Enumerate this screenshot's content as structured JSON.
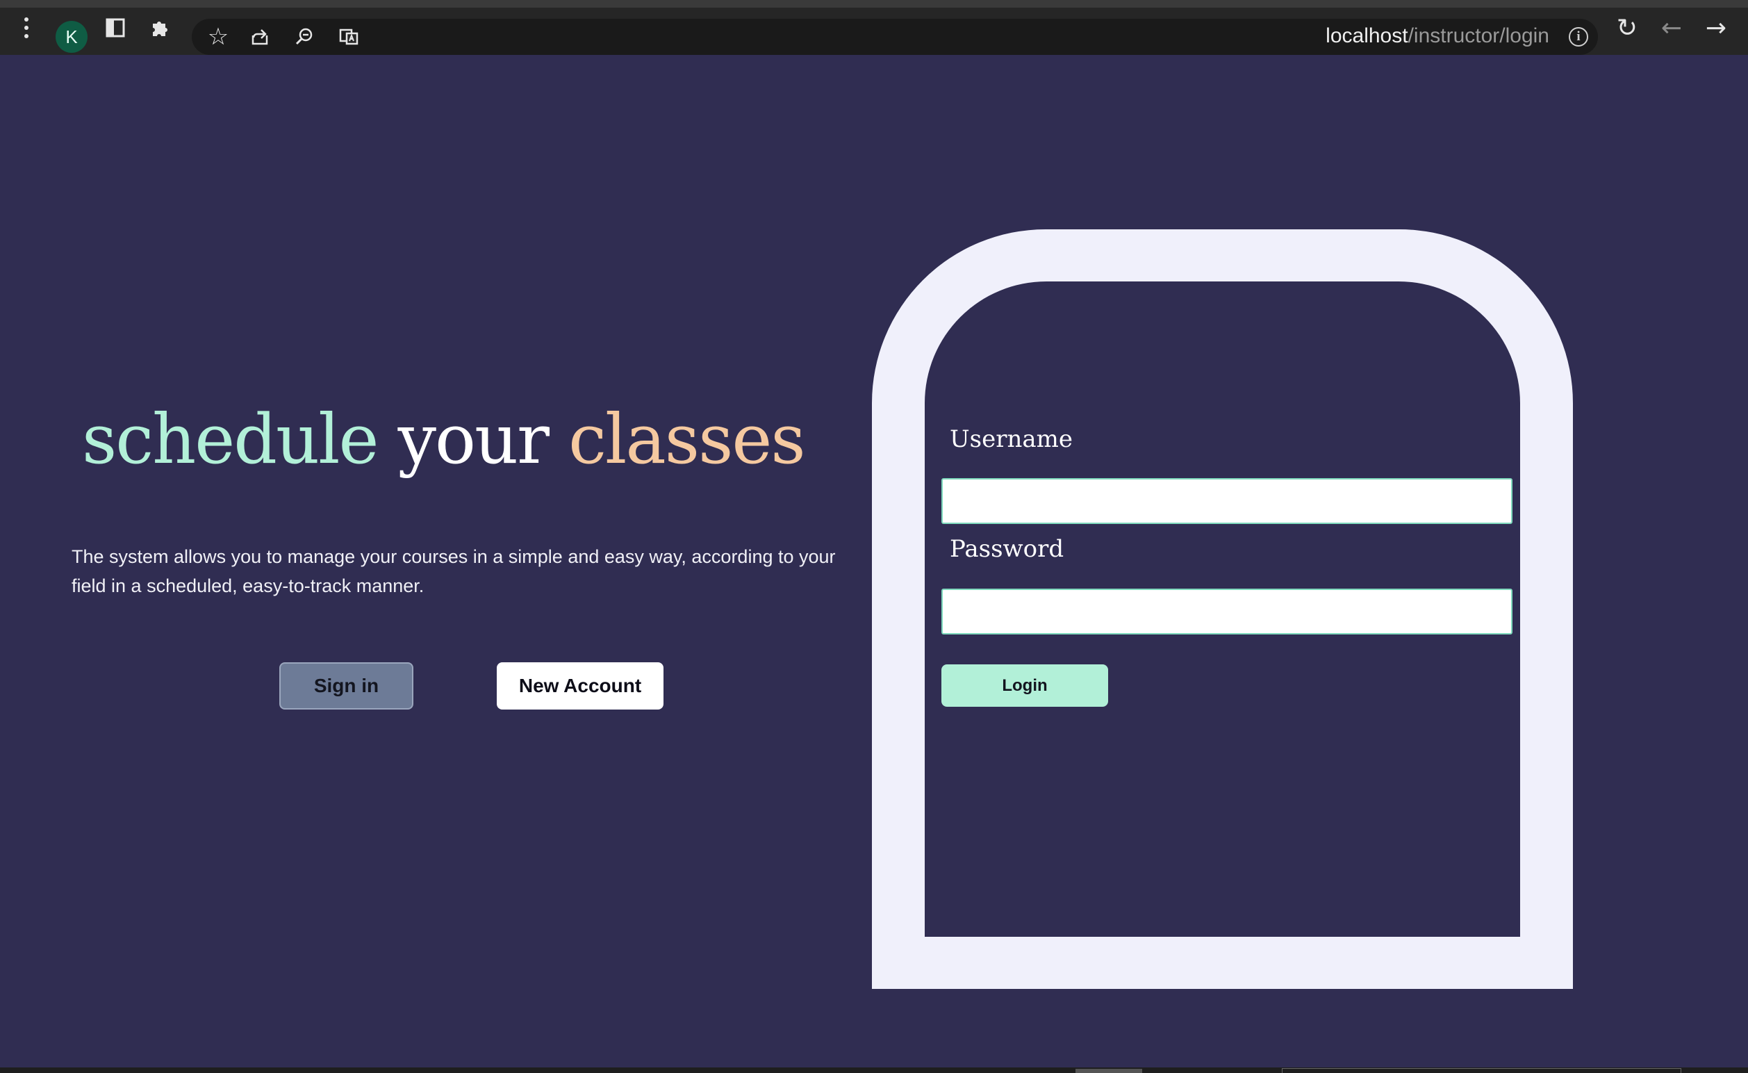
{
  "browser": {
    "profile_initial": "K",
    "url_host": "localhost",
    "url_path": "/instructor/login",
    "icons": {
      "menu": "kebab-menu-icon",
      "sidebar": "sidebar-icon",
      "extensions": "puzzle-icon",
      "bookmark": "star-icon",
      "share": "share-icon",
      "zoom": "zoom-icon",
      "translate": "translate-icon",
      "site_info": "info-icon",
      "reload": "reload-icon",
      "back": "back-arrow-icon",
      "forward": "forward-arrow-icon"
    }
  },
  "hero": {
    "headline_part1": "schedule",
    "headline_part2": "your",
    "headline_part3": "classes",
    "description": "The system allows you to manage your courses in a simple and easy way, according to your field in a scheduled, easy-to-track manner.",
    "signin_label": "Sign in",
    "new_account_label": "New Account"
  },
  "login_form": {
    "username_label": "Username",
    "username_value": "",
    "password_label": "Password",
    "password_value": "",
    "login_label": "Login"
  },
  "colors": {
    "page_background": "#302d52",
    "headline_mint": "#b2f0d8",
    "headline_peach": "#f5c9a0",
    "card_frame": "#f0f0fb",
    "signin_button": "#6d7b97",
    "login_button": "#b2f0d8"
  }
}
